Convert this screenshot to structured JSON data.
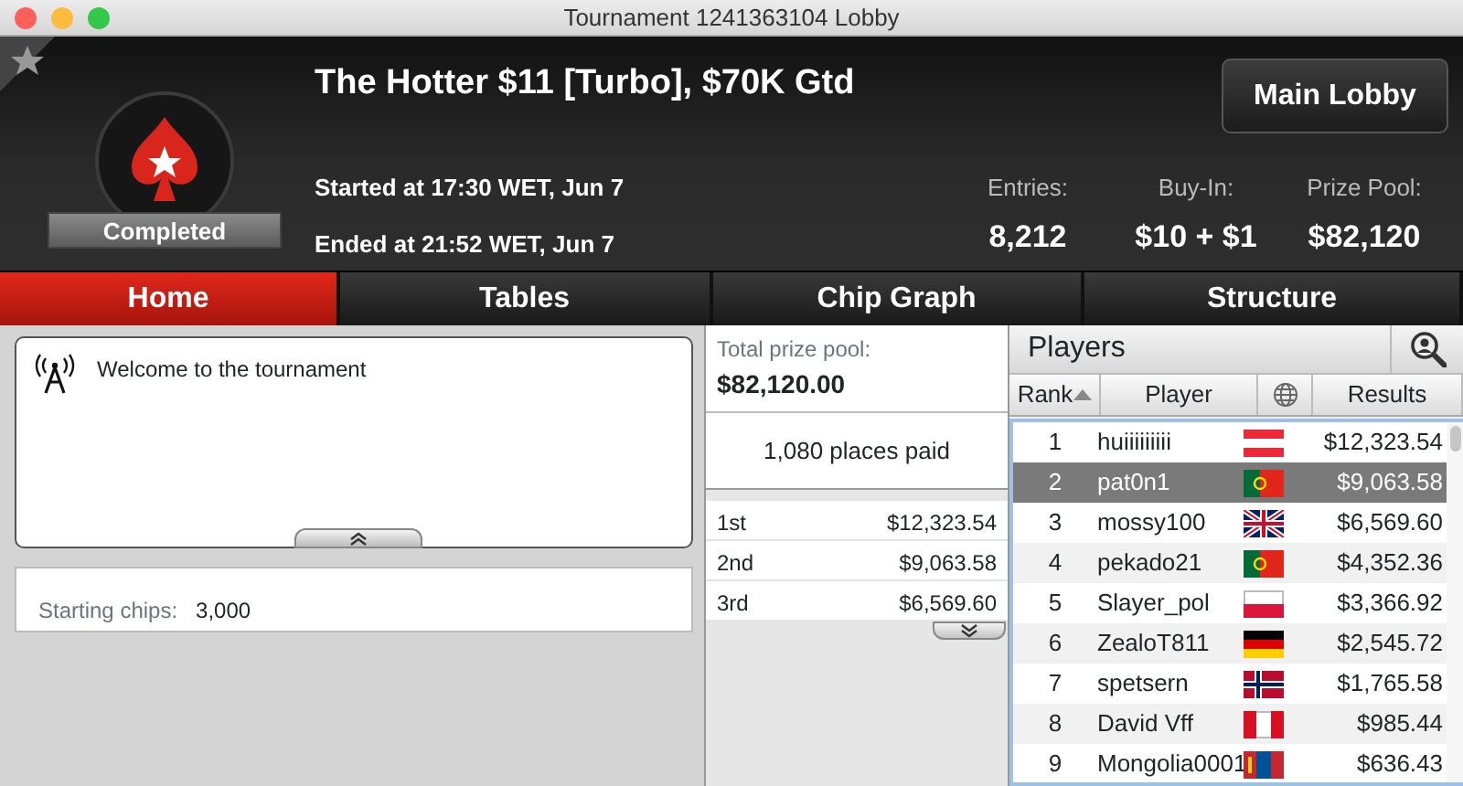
{
  "window": {
    "title": "Tournament 1241363104 Lobby"
  },
  "header": {
    "title": "The Hotter $11 [Turbo], $70K Gtd",
    "status": "Completed",
    "started": "Started at 17:30 WET, Jun 7",
    "ended": "Ended at 21:52 WET, Jun 7",
    "main_lobby": "Main Lobby",
    "stats": [
      {
        "label": "Entries:",
        "value": "8,212"
      },
      {
        "label": "Buy-In:",
        "value": "$10 + $1"
      },
      {
        "label": "Prize Pool:",
        "value": "$82,120"
      }
    ]
  },
  "tabs": [
    {
      "label": "Home",
      "selected": true
    },
    {
      "label": "Tables",
      "selected": false
    },
    {
      "label": "Chip Graph",
      "selected": false
    },
    {
      "label": "Structure",
      "selected": false
    }
  ],
  "news": {
    "text": "Welcome to the tournament"
  },
  "starting_chips": {
    "label": "Starting chips:",
    "value": "3,000"
  },
  "prizes": {
    "total_label": "Total prize pool:",
    "total": "$82,120.00",
    "places_paid": "1,080 places paid",
    "rows": [
      {
        "place": "1st",
        "amount": "$12,323.54"
      },
      {
        "place": "2nd",
        "amount": "$9,063.58"
      },
      {
        "place": "3rd",
        "amount": "$6,569.60"
      }
    ]
  },
  "players": {
    "title": "Players",
    "columns": [
      "Rank",
      "Player",
      "Results"
    ],
    "rows": [
      {
        "rank": "1",
        "player": "huiiiiiiiii",
        "kind": "austria",
        "result": "$12,323.54",
        "selected": false
      },
      {
        "rank": "2",
        "player": "pat0n1",
        "kind": "portugal",
        "result": "$9,063.58",
        "selected": true
      },
      {
        "rank": "3",
        "player": "mossy100",
        "kind": "britain",
        "result": "$6,569.60",
        "selected": false
      },
      {
        "rank": "4",
        "player": "pekado21",
        "kind": "portugal",
        "result": "$4,352.36",
        "selected": false
      },
      {
        "rank": "5",
        "player": "Slayer_pol",
        "kind": "poland",
        "result": "$3,366.92",
        "selected": false
      },
      {
        "rank": "6",
        "player": "ZealoT811",
        "kind": "germany",
        "result": "$2,545.72",
        "selected": false
      },
      {
        "rank": "7",
        "player": "spetsern",
        "kind": "norway",
        "result": "$1,765.58",
        "selected": false
      },
      {
        "rank": "8",
        "player": "David Vff",
        "kind": "peru",
        "result": "$985.44",
        "selected": false
      },
      {
        "rank": "9",
        "player": "Mongolia0001",
        "kind": "mongolia",
        "result": "$636.43",
        "selected": false
      }
    ]
  }
}
